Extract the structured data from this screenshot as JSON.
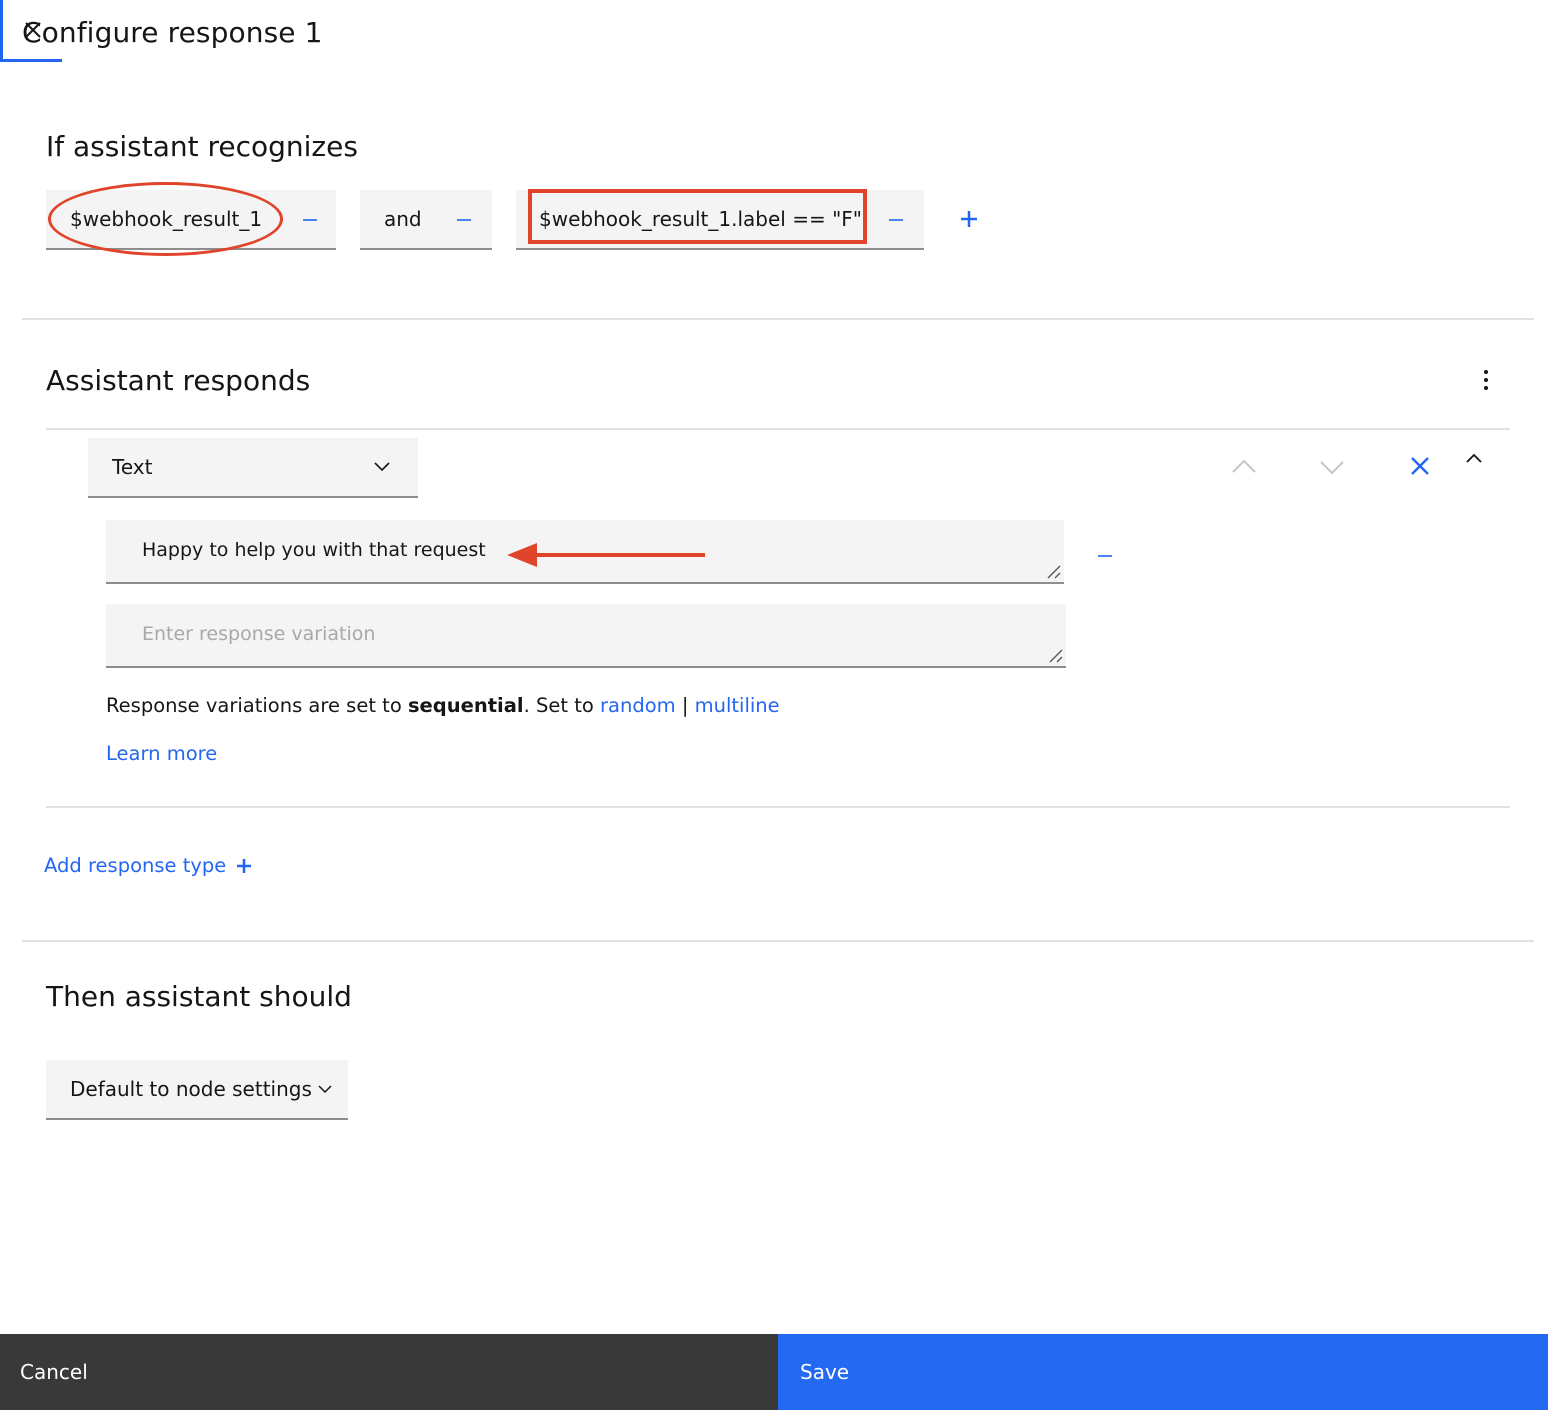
{
  "header": {
    "title": "Configure response 1",
    "close_icon": "close-icon"
  },
  "condition_section": {
    "title": "If assistant recognizes",
    "conditions": [
      {
        "value": "$webhook_result_1"
      },
      {
        "value": "and"
      },
      {
        "value": "$webhook_result_1.label == \"F\""
      }
    ],
    "remove_icon": "minus-icon",
    "add_icon": "plus-icon"
  },
  "responds_section": {
    "title": "Assistant responds",
    "overflow_icon": "overflow-menu-icon",
    "response_type": {
      "selected": "Text",
      "chevron_icon": "chevron-down-icon"
    },
    "controls": {
      "move_up_icon": "chevron-up-icon",
      "move_down_icon": "chevron-down-icon",
      "delete_icon": "close-icon",
      "collapse_icon": "chevron-up-icon"
    },
    "variations": [
      {
        "value": "Happy to help you with that request",
        "placeholder": ""
      },
      {
        "value": "",
        "placeholder": "Enter response variation"
      }
    ],
    "info": {
      "prefix": "Response variations are set to ",
      "mode": "sequential",
      "suffix": ". Set to ",
      "option_random": "random",
      "separator": " | ",
      "option_multiline": "multiline"
    },
    "learn_more": "Learn more",
    "add_response_type": "Add response type"
  },
  "then_section": {
    "title": "Then assistant should",
    "action": {
      "selected": "Default to node settings",
      "chevron_icon": "chevron-down-icon"
    }
  },
  "footer": {
    "cancel_label": "Cancel",
    "save_label": "Save"
  },
  "annotations": {
    "color": "#e0442b"
  },
  "colors": {
    "accent": "#2366f3",
    "footer_dark": "#393939",
    "field_bg": "#f4f4f4"
  }
}
